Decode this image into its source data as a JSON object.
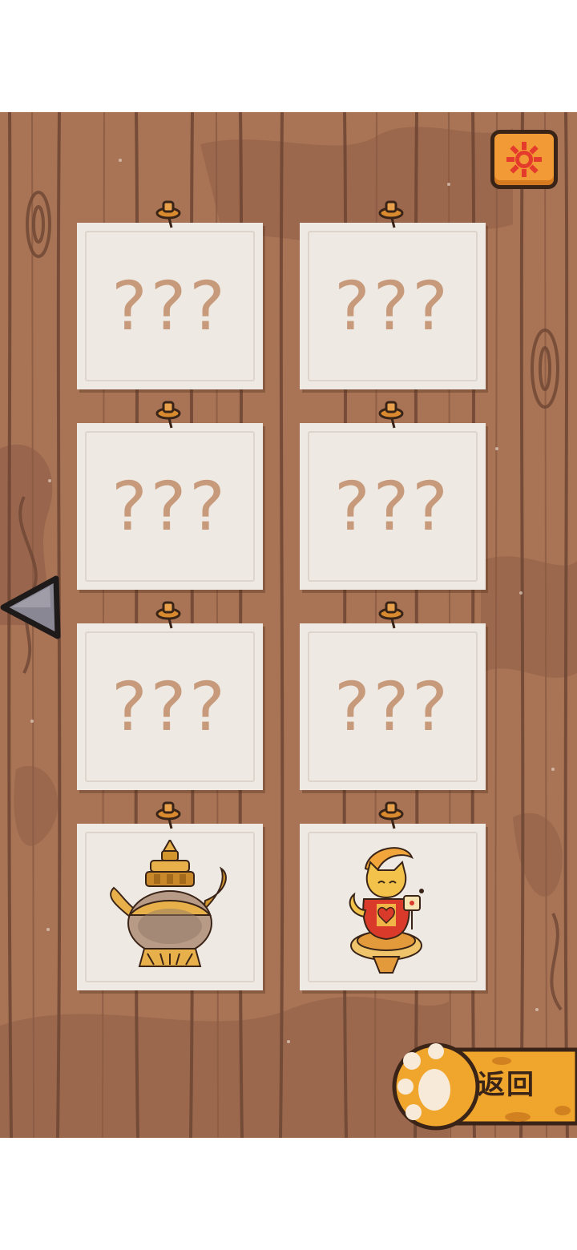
{
  "header": {
    "settings_icon": "gear-icon"
  },
  "cards": [
    {
      "locked": true,
      "label": "???"
    },
    {
      "locked": true,
      "label": "???"
    },
    {
      "locked": true,
      "label": "???"
    },
    {
      "locked": true,
      "label": "???"
    },
    {
      "locked": true,
      "label": "???"
    },
    {
      "locked": true,
      "label": "???"
    },
    {
      "locked": false,
      "item": "golden-teapot"
    },
    {
      "locked": false,
      "item": "cat-figurine"
    }
  ],
  "navigation": {
    "prev_icon": "triangle-left-icon",
    "back_label": "返回",
    "back_icon": "paw-icon"
  },
  "colors": {
    "wood": "#a87455",
    "accent_orange": "#f29a35",
    "paper": "#efe9e3",
    "question_mark": "#c69a7a"
  }
}
